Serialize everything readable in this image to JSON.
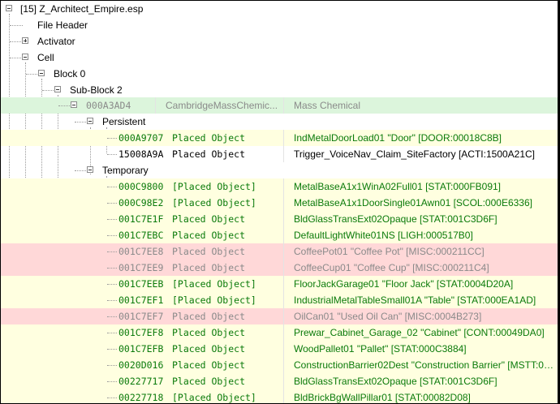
{
  "tree": {
    "root": "[15] Z_Architect_Empire.esp",
    "file_header": "File Header",
    "activator": "Activator",
    "cell": "Cell",
    "block": "Block 0",
    "sub_block": "Sub-Block 2",
    "cell_record": {
      "formid": "000A3AD4",
      "editor_id": "CambridgeMassChemic...",
      "name": "Mass Chemical"
    },
    "persistent": "Persistent",
    "temporary": "Temporary"
  },
  "persistent_items": [
    {
      "formid": "000A9707",
      "type": "Placed Object",
      "ref": "IndMetalDoorLoad01 \"Door\" [DOOR:00018C8B]",
      "style": "green",
      "band": "yellow"
    },
    {
      "formid": "15008A9A",
      "type": "Placed Object",
      "ref": "Trigger_VoiceNav_Claim_SiteFactory [ACTI:1500A21C]",
      "style": "dark",
      "band": "none"
    }
  ],
  "temporary_items": [
    {
      "formid": "000C9800",
      "type": "[Placed Object]",
      "ref": "MetalBaseA1x1WinA02Full01 [STAT:000FB091]",
      "style": "green",
      "band": "yellow"
    },
    {
      "formid": "000C98E2",
      "type": "[Placed Object]",
      "ref": "MetalBaseA1x1DoorSingle01Awn01 [SCOL:000E6336]",
      "style": "green",
      "band": "yellow"
    },
    {
      "formid": "001C7E1F",
      "type": "Placed Object",
      "ref": "BldGlassTransExt02Opaque [STAT:001C3D6F]",
      "style": "green",
      "band": "yellow"
    },
    {
      "formid": "001C7EBC",
      "type": "Placed Object",
      "ref": "DefaultLightWhite01NS [LIGH:000517B0]",
      "style": "green",
      "band": "yellow"
    },
    {
      "formid": "001C7EE8",
      "type": "Placed Object",
      "ref": "CoffeePot01 \"Coffee Pot\" [MISC:000211CC]",
      "style": "gray",
      "band": "red"
    },
    {
      "formid": "001C7EE9",
      "type": "Placed Object",
      "ref": "CoffeeCup01 \"Coffee Cup\" [MISC:000211C4]",
      "style": "gray",
      "band": "red"
    },
    {
      "formid": "001C7EEB",
      "type": "[Placed Object]",
      "ref": "FloorJackGarage01 \"Floor Jack\" [STAT:0004D20A]",
      "style": "green",
      "band": "yellow"
    },
    {
      "formid": "001C7EF1",
      "type": "[Placed Object]",
      "ref": "IndustrialMetalTableSmall01A \"Table\" [STAT:000EA1AD]",
      "style": "green",
      "band": "yellow"
    },
    {
      "formid": "001C7EF7",
      "type": "Placed Object",
      "ref": "OilCan01 \"Used Oil Can\" [MISC:0004B273]",
      "style": "gray",
      "band": "red"
    },
    {
      "formid": "001C7EF8",
      "type": "Placed Object",
      "ref": "Prewar_Cabinet_Garage_02 \"Cabinet\" [CONT:00049DA0]",
      "style": "green",
      "band": "yellow"
    },
    {
      "formid": "001C7EFB",
      "type": "Placed Object",
      "ref": "WoodPallet01 \"Pallet\" [STAT:000C3884]",
      "style": "green",
      "band": "yellow"
    },
    {
      "formid": "0020D016",
      "type": "Placed Object",
      "ref": "ConstructionBarrier02Dest \"Construction Barrier\" [MSTT:000...",
      "style": "green",
      "band": "yellow"
    },
    {
      "formid": "00227717",
      "type": "Placed Object",
      "ref": "BldGlassTransExt02Opaque [STAT:001C3D6F]",
      "style": "green",
      "band": "yellow"
    },
    {
      "formid": "00227718",
      "type": "[Placed Object]",
      "ref": "BldBrickBgWallPillar01 [STAT:00082D08]",
      "style": "green",
      "band": "yellow"
    }
  ]
}
